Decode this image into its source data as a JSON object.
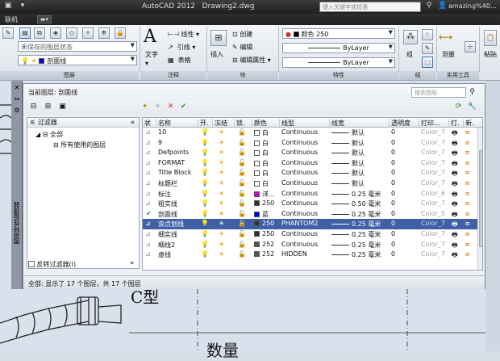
{
  "titlebar": {
    "app": "AutoCAD 2012",
    "document": "Drawing2.dwg",
    "search_placeholder": "键入关键字或短语",
    "user": "amazing%40..."
  },
  "ribbon_tabs": {
    "label": "联机"
  },
  "ribbon": {
    "layers": {
      "state_combo": "未保存的图层状态",
      "current_layer": "剖面线",
      "footer": "图层"
    },
    "annotation": {
      "text_label": "文字",
      "linear_label": "线性",
      "leader_label": "引线",
      "table_label": "表格",
      "footer": "注释"
    },
    "block": {
      "insert_label": "插入",
      "create_label": "创建",
      "edit_label": "编辑",
      "edit_attr_label": "编辑属性",
      "footer": "块"
    },
    "properties": {
      "color_label": "颜色 250",
      "linetype": "ByLayer",
      "lineweight": "ByLayer",
      "footer": "特性"
    },
    "groups": {
      "group_label": "组",
      "footer": "组"
    },
    "utilities": {
      "measure_label": "测量",
      "footer": "实用工具"
    },
    "clipboard": {
      "paste_label": "粘贴"
    }
  },
  "palette_strip": {
    "vertical_title": "图层特性管理器"
  },
  "layer_manager": {
    "current_layer_label": "当前图层: 剖面线",
    "search_placeholder": "搜索图层",
    "filter_tree": {
      "header": "过滤器",
      "all": "全部",
      "used": "所有使用的图层",
      "invert_label": "反转过滤器(I)"
    },
    "columns": [
      "状",
      "名称",
      "开.",
      "冻结",
      "锁.",
      "颜色",
      "线型",
      "线宽",
      "透明度",
      "打印...",
      "打.",
      "新."
    ],
    "rows": [
      {
        "status": "",
        "name": "10",
        "color_name": "白",
        "color_hex": "#ffffff",
        "linetype": "Continuous",
        "lineweight": "默认",
        "transparency": "0",
        "plotstyle": "Color_7"
      },
      {
        "status": "",
        "name": "9",
        "color_name": "白",
        "color_hex": "#ffffff",
        "linetype": "Continuous",
        "lineweight": "默认",
        "transparency": "0",
        "plotstyle": "Color_7"
      },
      {
        "status": "",
        "name": "Defpoints",
        "color_name": "白",
        "color_hex": "#ffffff",
        "linetype": "Continuous",
        "lineweight": "默认",
        "transparency": "0",
        "plotstyle": "Color_7"
      },
      {
        "status": "",
        "name": "FORMAT",
        "color_name": "白",
        "color_hex": "#ffffff",
        "linetype": "Continuous",
        "lineweight": "默认",
        "transparency": "0",
        "plotstyle": "Color_7"
      },
      {
        "status": "",
        "name": "Title Block",
        "color_name": "白",
        "color_hex": "#ffffff",
        "linetype": "Continuous",
        "lineweight": "默认",
        "transparency": "0",
        "plotstyle": "Color_7"
      },
      {
        "status": "",
        "name": "标题栏",
        "color_name": "白",
        "color_hex": "#ffffff",
        "linetype": "Continuous",
        "lineweight": "默认",
        "transparency": "0",
        "plotstyle": "Color_7"
      },
      {
        "status": "",
        "name": "标注",
        "color_name": "洋...",
        "color_hex": "#d400d4",
        "linetype": "Continuous",
        "lineweight": "0.25 毫米",
        "transparency": "0",
        "plotstyle": "Color_6"
      },
      {
        "status": "",
        "name": "粗实线",
        "color_name": "250",
        "color_hex": "#333333",
        "linetype": "Continuous",
        "lineweight": "0.50 毫米",
        "transparency": "0",
        "plotstyle": "Color_7"
      },
      {
        "status": "✔",
        "name": "剖面线",
        "color_name": "蓝",
        "color_hex": "#0000ee",
        "linetype": "Continuous",
        "lineweight": "0.25 毫米",
        "transparency": "0",
        "plotstyle": "Color_5"
      },
      {
        "status": "",
        "name": "双点划线",
        "color_name": "250",
        "color_hex": "#333333",
        "linetype": "PHANTOM2",
        "lineweight": "0.25 毫米",
        "transparency": "0",
        "plotstyle": "Color_7",
        "selected": true
      },
      {
        "status": "",
        "name": "细实线",
        "color_name": "250",
        "color_hex": "#333333",
        "linetype": "Continuous",
        "lineweight": "0.25 毫米",
        "transparency": "0",
        "plotstyle": "Color_7"
      },
      {
        "status": "",
        "name": "细线2",
        "color_name": "252",
        "color_hex": "#555555",
        "linetype": "Continuous",
        "lineweight": "0.25 毫米",
        "transparency": "0",
        "plotstyle": "Color_7"
      },
      {
        "status": "",
        "name": "虚线",
        "color_name": "252",
        "color_hex": "#555555",
        "linetype": "HIDDEN",
        "lineweight": "0.25 毫米",
        "transparency": "0",
        "plotstyle": "Color_7"
      }
    ],
    "status_text": "全部: 显示了 17 个图层，共 17 个图层"
  },
  "drawing": {
    "label_1": "C型",
    "label_2": "数量"
  },
  "colors": {
    "selection": "#3f5fa6",
    "drawing_bg": "#d9e1ec",
    "titlebar": "#2a2a2a"
  }
}
